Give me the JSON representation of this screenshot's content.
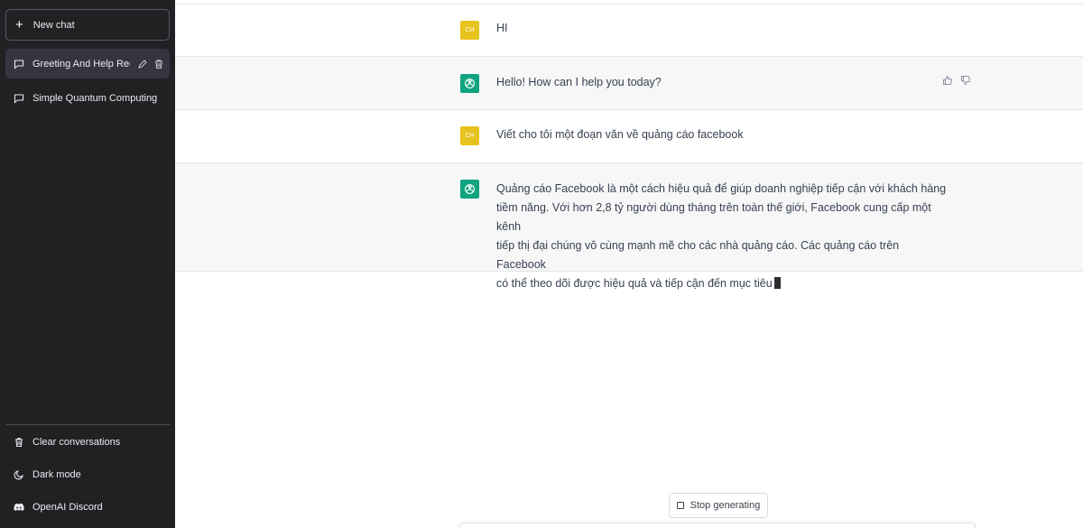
{
  "sidebar": {
    "new_chat_label": "New chat",
    "conversations": [
      {
        "title": "Greeting And Help Req",
        "active": true
      },
      {
        "title": "Simple Quantum Computing E",
        "active": false
      }
    ],
    "bottom": {
      "clear_label": "Clear conversations",
      "dark_mode_label": "Dark mode",
      "discord_label": "OpenAI Discord"
    }
  },
  "chat": {
    "messages": [
      {
        "role": "user",
        "avatar": "CH",
        "text": "HI"
      },
      {
        "role": "assistant",
        "text": "Hello! How can I help you today?"
      },
      {
        "role": "user",
        "avatar": "CH",
        "text": "Viết cho tôi một đoạn văn về quảng cáo facebook"
      },
      {
        "role": "assistant",
        "lines": [
          "Quảng cáo Facebook là một cách hiệu quả để giúp doanh nghiệp tiếp cận với khách hàng",
          "tiềm năng. Với hơn 2,8 tỷ người dùng tháng trên toàn thế giới, Facebook cung cấp một kênh",
          "tiếp thị đại chúng vô cùng mạnh mẽ cho các nhà quảng cáo. Các quảng cáo trên Facebook",
          "có thể theo dõi được hiệu quả và tiếp cận đến mục tiêu"
        ]
      }
    ],
    "stop_label": "Stop generating"
  },
  "colors": {
    "sidebar_bg": "#202123",
    "bot_avatar": "#10a37f",
    "user_avatar": "#e6c31d",
    "bot_row_bg": "#f7f7f8"
  }
}
